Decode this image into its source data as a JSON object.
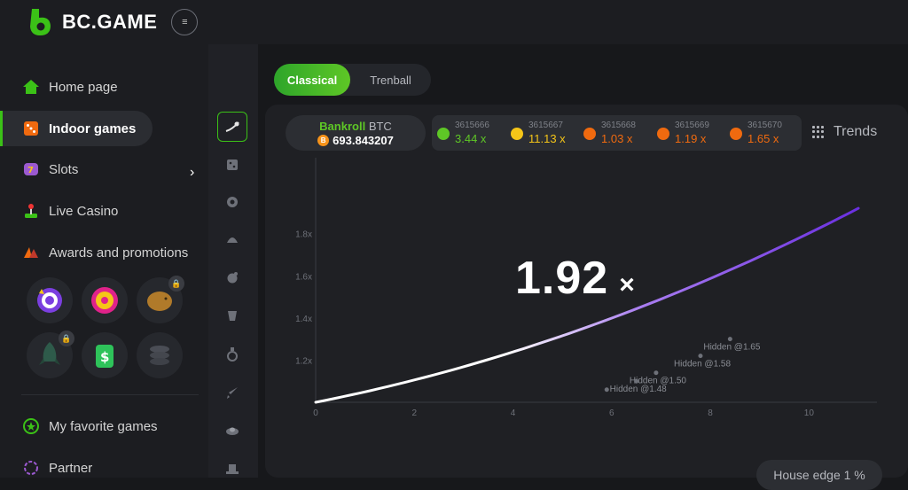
{
  "header": {
    "logo_text": "BC.GAME",
    "menu_icon": "hamburger-icon"
  },
  "sidebar": {
    "items": [
      {
        "label": "Home page",
        "icon": "home-icon"
      },
      {
        "label": "Indoor games",
        "icon": "dice-icon",
        "active": true
      },
      {
        "label": "Slots",
        "icon": "slots-icon"
      },
      {
        "label": "Live Casino",
        "icon": "joystick-icon"
      },
      {
        "label": "Awards and promotions",
        "icon": "gift-icon"
      },
      {
        "label": "My favorite games",
        "icon": "star-icon"
      },
      {
        "label": "Partner",
        "icon": "partner-icon"
      }
    ],
    "promos": [
      {
        "icon": "spin-target-icon",
        "locked": false
      },
      {
        "icon": "lucky-wheel-icon",
        "locked": false
      },
      {
        "icon": "piggy-bank-icon",
        "locked": true
      },
      {
        "icon": "rocket-icon",
        "locked": true
      },
      {
        "icon": "dollar-tag-icon",
        "locked": false
      },
      {
        "icon": "coin-stack-icon",
        "locked": false
      }
    ]
  },
  "rail": {
    "items": [
      "crash-icon",
      "dice-game-icon",
      "roulette-icon",
      "mines-icon",
      "plinko-icon",
      "tower-icon",
      "ring-icon",
      "sword-icon",
      "ufo-icon",
      "hat-icon"
    ]
  },
  "tabs": {
    "classical": "Classical",
    "trenball": "Trenball"
  },
  "bankroll": {
    "label": "Bankroll",
    "currency": "BTC",
    "amount": "693.843207"
  },
  "history": [
    {
      "id": "3615666",
      "value": "3.44 x",
      "color": "#5ec726"
    },
    {
      "id": "3615667",
      "value": "11.13 x",
      "color": "#f5c518"
    },
    {
      "id": "3615668",
      "value": "1.03 x",
      "color": "#f06a0f"
    },
    {
      "id": "3615669",
      "value": "1.19 x",
      "color": "#f06a0f"
    },
    {
      "id": "3615670",
      "value": "1.65 x",
      "color": "#f06a0f"
    }
  ],
  "trends_label": "Trends",
  "game": {
    "multiplier": "1.92",
    "multiplier_suffix": "×",
    "house_edge": "House edge 1 %"
  },
  "chart_data": {
    "type": "line",
    "x_ticks": [
      "0",
      "2",
      "4",
      "6",
      "8",
      "10"
    ],
    "y_ticks": [
      "1.2x",
      "1.4x",
      "1.6x",
      "1.8x"
    ],
    "xlim": [
      0,
      11
    ],
    "ylim": [
      1.0,
      1.95
    ],
    "curve": {
      "x_end": 11,
      "y_end": 1.92
    },
    "hidden_markers": [
      {
        "label": "Hidden @1.65",
        "x": 8.4,
        "y": 1.3
      },
      {
        "label": "Hidden @1.58",
        "x": 7.8,
        "y": 1.22
      },
      {
        "label": "Hidden @1.50",
        "x": 6.9,
        "y": 1.14
      },
      {
        "label": "Hidden @1.48",
        "x": 6.5,
        "y": 1.1
      },
      {
        "label": "",
        "x": 5.9,
        "y": 1.06
      }
    ]
  }
}
